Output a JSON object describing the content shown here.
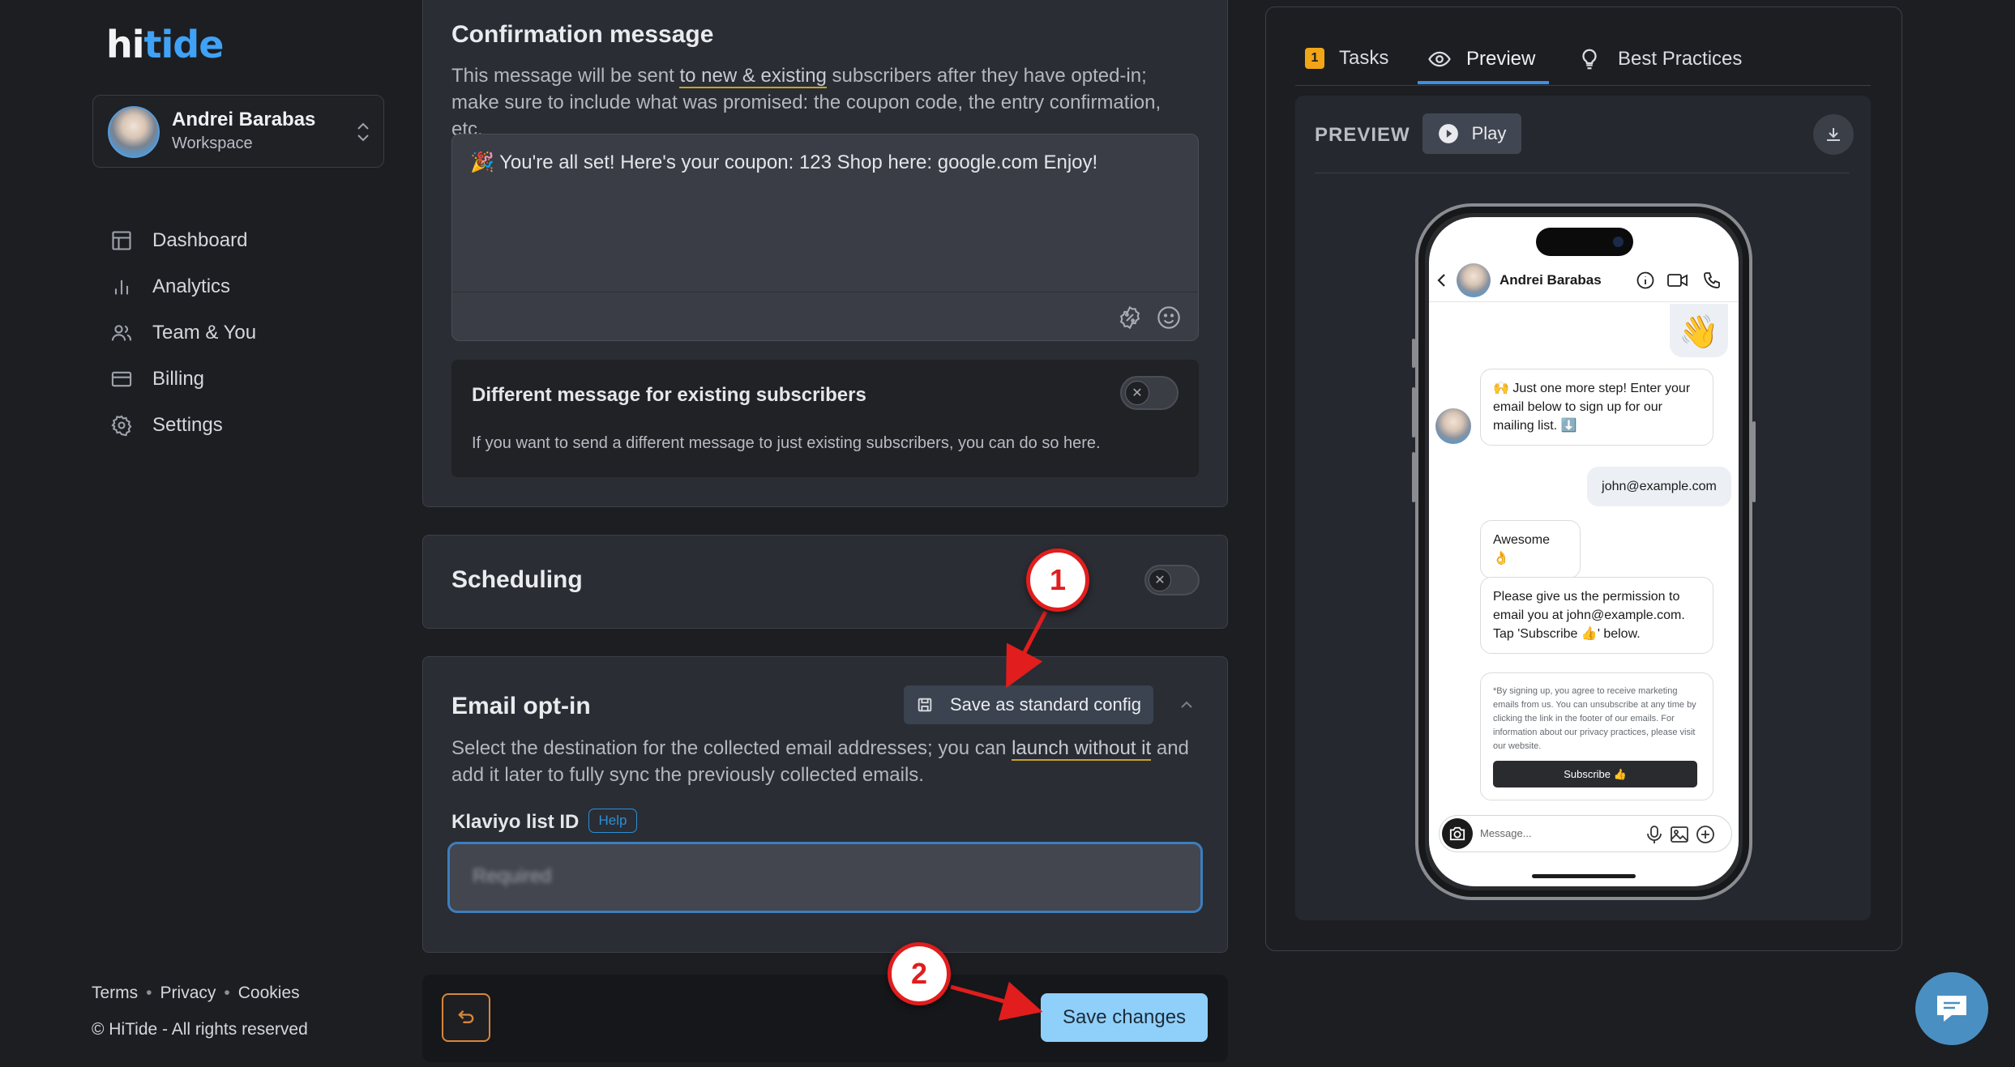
{
  "brand": {
    "logo_hi": "hi",
    "logo_tide": "tide"
  },
  "workspace": {
    "name": "Andrei Barabas",
    "label": "Workspace"
  },
  "nav": [
    {
      "label": "Dashboard",
      "icon": "layout-icon"
    },
    {
      "label": "Analytics",
      "icon": "bar-chart-icon"
    },
    {
      "label": "Team & You",
      "icon": "users-icon"
    },
    {
      "label": "Billing",
      "icon": "credit-card-icon"
    },
    {
      "label": "Settings",
      "icon": "gear-icon"
    }
  ],
  "footer": {
    "terms": "Terms",
    "privacy": "Privacy",
    "cookies": "Cookies",
    "copyright": "© HiTide - All rights reserved"
  },
  "confirmation": {
    "title": "Confirmation message",
    "desc_before": "This message will be sent ",
    "desc_link": "to new & existing",
    "desc_after": " subscribers after they have opted-in; make sure to include what was promised: the coupon code, the entry confirmation, etc.",
    "message": "🎉 You're all set! Here's your coupon: 123 Shop here: google.com Enjoy!",
    "diff_title": "Different message for existing subscribers",
    "diff_desc": "If you want to send a different message to just existing subscribers, you can do so here.",
    "toggle_on": false
  },
  "scheduling": {
    "title": "Scheduling",
    "toggle_on": false
  },
  "email_optin": {
    "title": "Email opt-in",
    "save_std": "Save as standard config",
    "desc_before": "Select the destination for the collected email addresses; you can ",
    "desc_link": "launch without it",
    "desc_after": " and add it later to fully sync the previously collected emails.",
    "field_label": "Klaviyo list ID",
    "help": "Help",
    "placeholder": "Required"
  },
  "actions": {
    "save": "Save changes"
  },
  "right": {
    "tabs": [
      {
        "label": "Tasks",
        "badge": "1"
      },
      {
        "label": "Preview"
      },
      {
        "label": "Best Practices"
      }
    ],
    "active_tab": "Preview",
    "preview_label": "PREVIEW",
    "play": "Play"
  },
  "phone": {
    "contact": "Andrei Barabas",
    "wave": "👋",
    "msg1": "🙌 Just one more step! Enter your email below to sign up for our mailing list. ⬇️",
    "reply": "john@example.com",
    "msg2": "Awesome 👌",
    "msg3": "Please give us the permission to email you at john@example.com. Tap 'Subscribe 👍' below.",
    "legal": "*By signing up, you agree to receive marketing emails from us. You can unsubscribe at any time by clicking the link in the footer of our emails. For information about our privacy practices, please visit our website.",
    "subscribe": "Subscribe 👍",
    "compose_placeholder": "Message..."
  },
  "annotations": [
    {
      "label": "1"
    },
    {
      "label": "2"
    }
  ],
  "colors": {
    "accent": "#3fa2f6",
    "annotation": "#e11d1d",
    "save_btn": "#8fd0fb",
    "tasks_badge": "#f2a516"
  }
}
